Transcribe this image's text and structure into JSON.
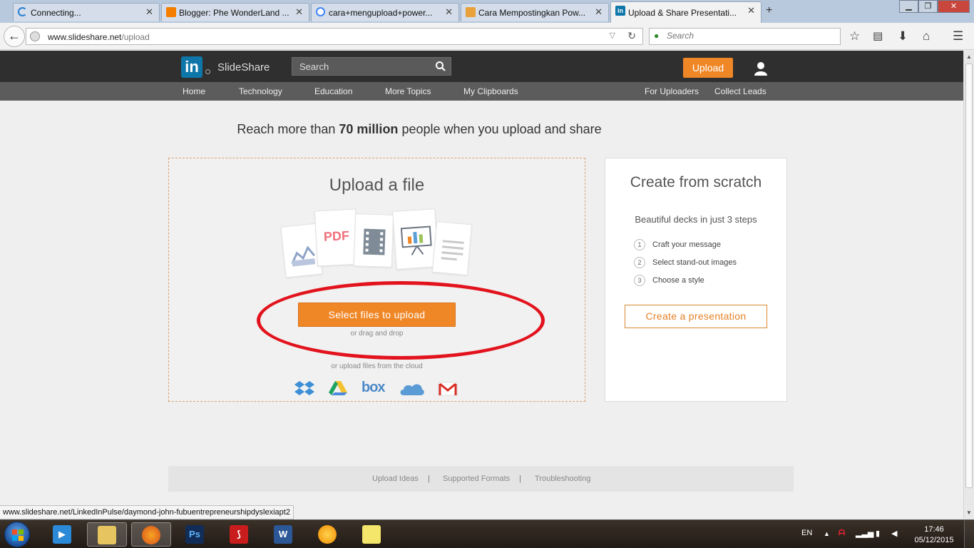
{
  "browser": {
    "tabs": [
      {
        "title": "Connecting...",
        "active": false
      },
      {
        "title": "Blogger: Phe WonderLand ...",
        "active": false
      },
      {
        "title": "cara+mengupload+power...",
        "active": false
      },
      {
        "title": "Cara Mempostingkan Pow...",
        "active": false
      },
      {
        "title": "Upload & Share Presentati...",
        "active": true
      }
    ],
    "url_domain": "www.slideshare.net",
    "url_path": "/upload",
    "search_placeholder": "Search",
    "status_url": "www.slideshare.net/LinkedInPulse/daymond-john-fubuentrepreneurshipdyslexiapt2"
  },
  "site": {
    "brand": "SlideShare",
    "search_placeholder": "Search",
    "upload_label": "Upload",
    "menu": [
      "Home",
      "Technology",
      "Education",
      "More Topics",
      "My Clipboards"
    ],
    "menu_right": [
      "For Uploaders",
      "Collect Leads"
    ]
  },
  "main": {
    "headline_pre": "Reach more than ",
    "headline_bold": "70 million",
    "headline_post": " people when you upload and share",
    "upload": {
      "title": "Upload a file",
      "select_label": "Select files to upload",
      "drag_text": "or drag and drop",
      "cloud_text": "or upload files from the cloud",
      "pdf_label": "PDF",
      "cloud_services": [
        "dropbox-icon",
        "google-drive-icon",
        "box-icon",
        "onedrive-icon",
        "gmail-icon"
      ],
      "box_label": "box"
    },
    "scratch": {
      "title": "Create from scratch",
      "subtitle": "Beautiful decks in just 3 steps",
      "steps": [
        {
          "num": "1",
          "text": "Craft your message"
        },
        {
          "num": "2",
          "text": "Select stand-out images"
        },
        {
          "num": "3",
          "text": "Choose a style"
        }
      ],
      "cta": "Create a presentation"
    },
    "footer_links": [
      "Upload Ideas",
      "Supported Formats",
      "Troubleshooting"
    ],
    "footer_sep": "|"
  },
  "taskbar": {
    "language": "EN",
    "time": "17:46",
    "date": "05/12/2015",
    "apps": [
      "media-player-icon",
      "file-explorer-icon",
      "firefox-icon",
      "photoshop-icon",
      "acrobat-icon",
      "word-icon",
      "app-orb-icon",
      "sticky-notes-icon"
    ],
    "ps_label": "Ps",
    "word_label": "W"
  },
  "colors": {
    "accent": "#f08727",
    "linkedin": "#0e76a8",
    "header_bg": "#2f2f2f",
    "menu_bg": "#5c5c5c",
    "annotation_ring": "#e2131d"
  }
}
